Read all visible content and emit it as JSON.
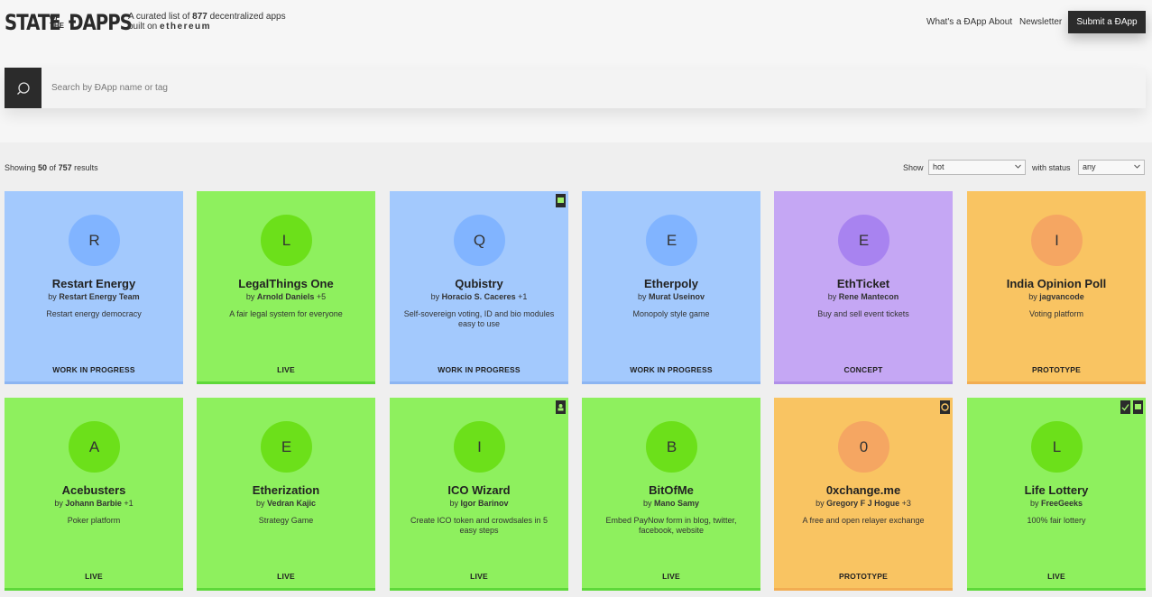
{
  "header": {
    "logo_line1": "STATE",
    "logo_of": "OF",
    "logo_the": "THE",
    "logo_dapps": "ĐAPPS",
    "tagline_pre": "A curated list of ",
    "tagline_count": "877",
    "tagline_post": " decentralized apps",
    "tagline_built": "built on ",
    "tagline_eth": "ethereum",
    "nav": [
      "What's a ĐApp",
      "About",
      "Newsletter"
    ],
    "submit_label": "Submit a ĐApp"
  },
  "search": {
    "placeholder": "Search by ĐApp name or tag",
    "icon": "search-icon"
  },
  "results": {
    "prefix": "Showing ",
    "shown": "50",
    "of": " of ",
    "total": "757",
    "suffix": " results"
  },
  "filters": {
    "show_label": "Show",
    "show_value": "hot",
    "status_label": "with status",
    "status_value": "any"
  },
  "cards": [
    {
      "letter": "R",
      "title": "Restart Energy",
      "by": "by ",
      "author": "Restart Energy Team",
      "extra": "",
      "desc": "Restart energy democracy",
      "status": "WORK IN PROGRESS",
      "type": "wip",
      "badges": []
    },
    {
      "letter": "L",
      "title": "LegalThings One",
      "by": "by ",
      "author": "Arnold Daniels",
      "extra": " +5",
      "desc": "A fair legal system for everyone",
      "status": "LIVE",
      "type": "live",
      "badges": []
    },
    {
      "letter": "Q",
      "title": "Qubistry",
      "by": "by ",
      "author": "Horacio S. Caceres",
      "extra": " +1",
      "desc": "Self-sovereign voting, ID and bio modules easy to use",
      "status": "WORK IN PROGRESS",
      "type": "wip",
      "badges": [
        "flag-icon"
      ]
    },
    {
      "letter": "E",
      "title": "Etherpoly",
      "by": "by ",
      "author": "Murat Useinov",
      "extra": "",
      "desc": "Monopoly style game",
      "status": "WORK IN PROGRESS",
      "type": "wip",
      "badges": []
    },
    {
      "letter": "E",
      "title": "EthTicket",
      "by": "by ",
      "author": "Rene Mantecon",
      "extra": "",
      "desc": "Buy and sell event tickets",
      "status": "CONCEPT",
      "type": "concept",
      "badges": []
    },
    {
      "letter": "I",
      "title": "India Opinion Poll",
      "by": "by ",
      "author": "jagvancode",
      "extra": "",
      "desc": "Voting platform",
      "status": "PROTOTYPE",
      "type": "proto",
      "badges": []
    },
    {
      "letter": "A",
      "title": "Acebusters",
      "by": "by ",
      "author": "Johann Barbie",
      "extra": " +1",
      "desc": "Poker platform",
      "status": "LIVE",
      "type": "live",
      "badges": []
    },
    {
      "letter": "E",
      "title": "Etherization",
      "by": "by ",
      "author": "Vedran Kajic",
      "extra": "",
      "desc": "Strategy Game",
      "status": "LIVE",
      "type": "live",
      "badges": []
    },
    {
      "letter": "I",
      "title": "ICO Wizard",
      "by": "by ",
      "author": "Igor Barinov",
      "extra": "",
      "desc": "Create ICO token and crowdsales in 5 easy steps",
      "status": "LIVE",
      "type": "live",
      "badges": [
        "user-icon"
      ]
    },
    {
      "letter": "B",
      "title": "BitOfMe",
      "by": "by ",
      "author": "Mano Samy",
      "extra": "",
      "desc": "Embed PayNow form in blog, twitter, facebook, website",
      "status": "LIVE",
      "type": "live",
      "badges": []
    },
    {
      "letter": "0",
      "title": "0xchange.me",
      "by": "by ",
      "author": "Gregory F J Hogue",
      "extra": " +3",
      "desc": "A free and open relayer exchange",
      "status": "PROTOTYPE",
      "type": "proto",
      "badges": [
        "github-icon"
      ]
    },
    {
      "letter": "L",
      "title": "Life Lottery",
      "by": "by ",
      "author": "FreeGeeks",
      "extra": "",
      "desc": "100% fair lottery",
      "status": "LIVE",
      "type": "live",
      "badges": [
        "check-icon",
        "flag-icon"
      ]
    }
  ]
}
